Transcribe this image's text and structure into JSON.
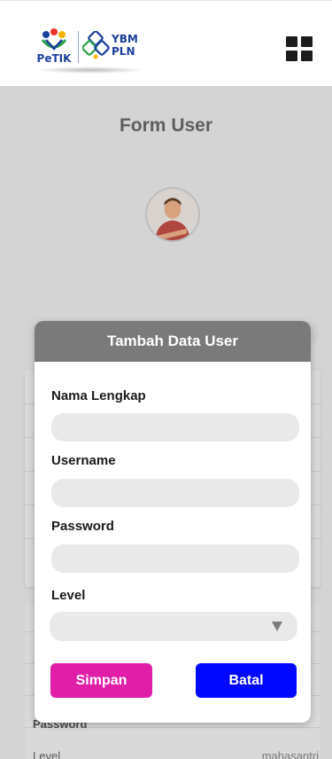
{
  "header": {
    "logo_left_text": "PeTIK",
    "logo_right_text": "YBM PLN"
  },
  "page": {
    "title": "Form User",
    "bg_rows": [
      {
        "label": "Password",
        "value": ""
      },
      {
        "label": "Level",
        "value": "mahasantri"
      }
    ]
  },
  "modal": {
    "title": "Tambah Data User",
    "fields": {
      "nama_lengkap": {
        "label": "Nama Lengkap",
        "value": "",
        "placeholder": ""
      },
      "username": {
        "label": "Username",
        "value": "",
        "placeholder": ""
      },
      "password": {
        "label": "Password",
        "value": "",
        "placeholder": ""
      },
      "level": {
        "label": "Level",
        "selected": ""
      }
    },
    "buttons": {
      "save_label": "Simpan",
      "cancel_label": "Batal"
    }
  },
  "colors": {
    "header_bg": "#ffffff",
    "overlay_bg": "#d4d4d4",
    "modal_header_bg": "#7a7a7a",
    "save_button": "#e01ea8",
    "cancel_button": "#0008ff"
  },
  "icons": {
    "menu": "grid-menu-icon",
    "select": "dropdown-triangle-icon"
  }
}
